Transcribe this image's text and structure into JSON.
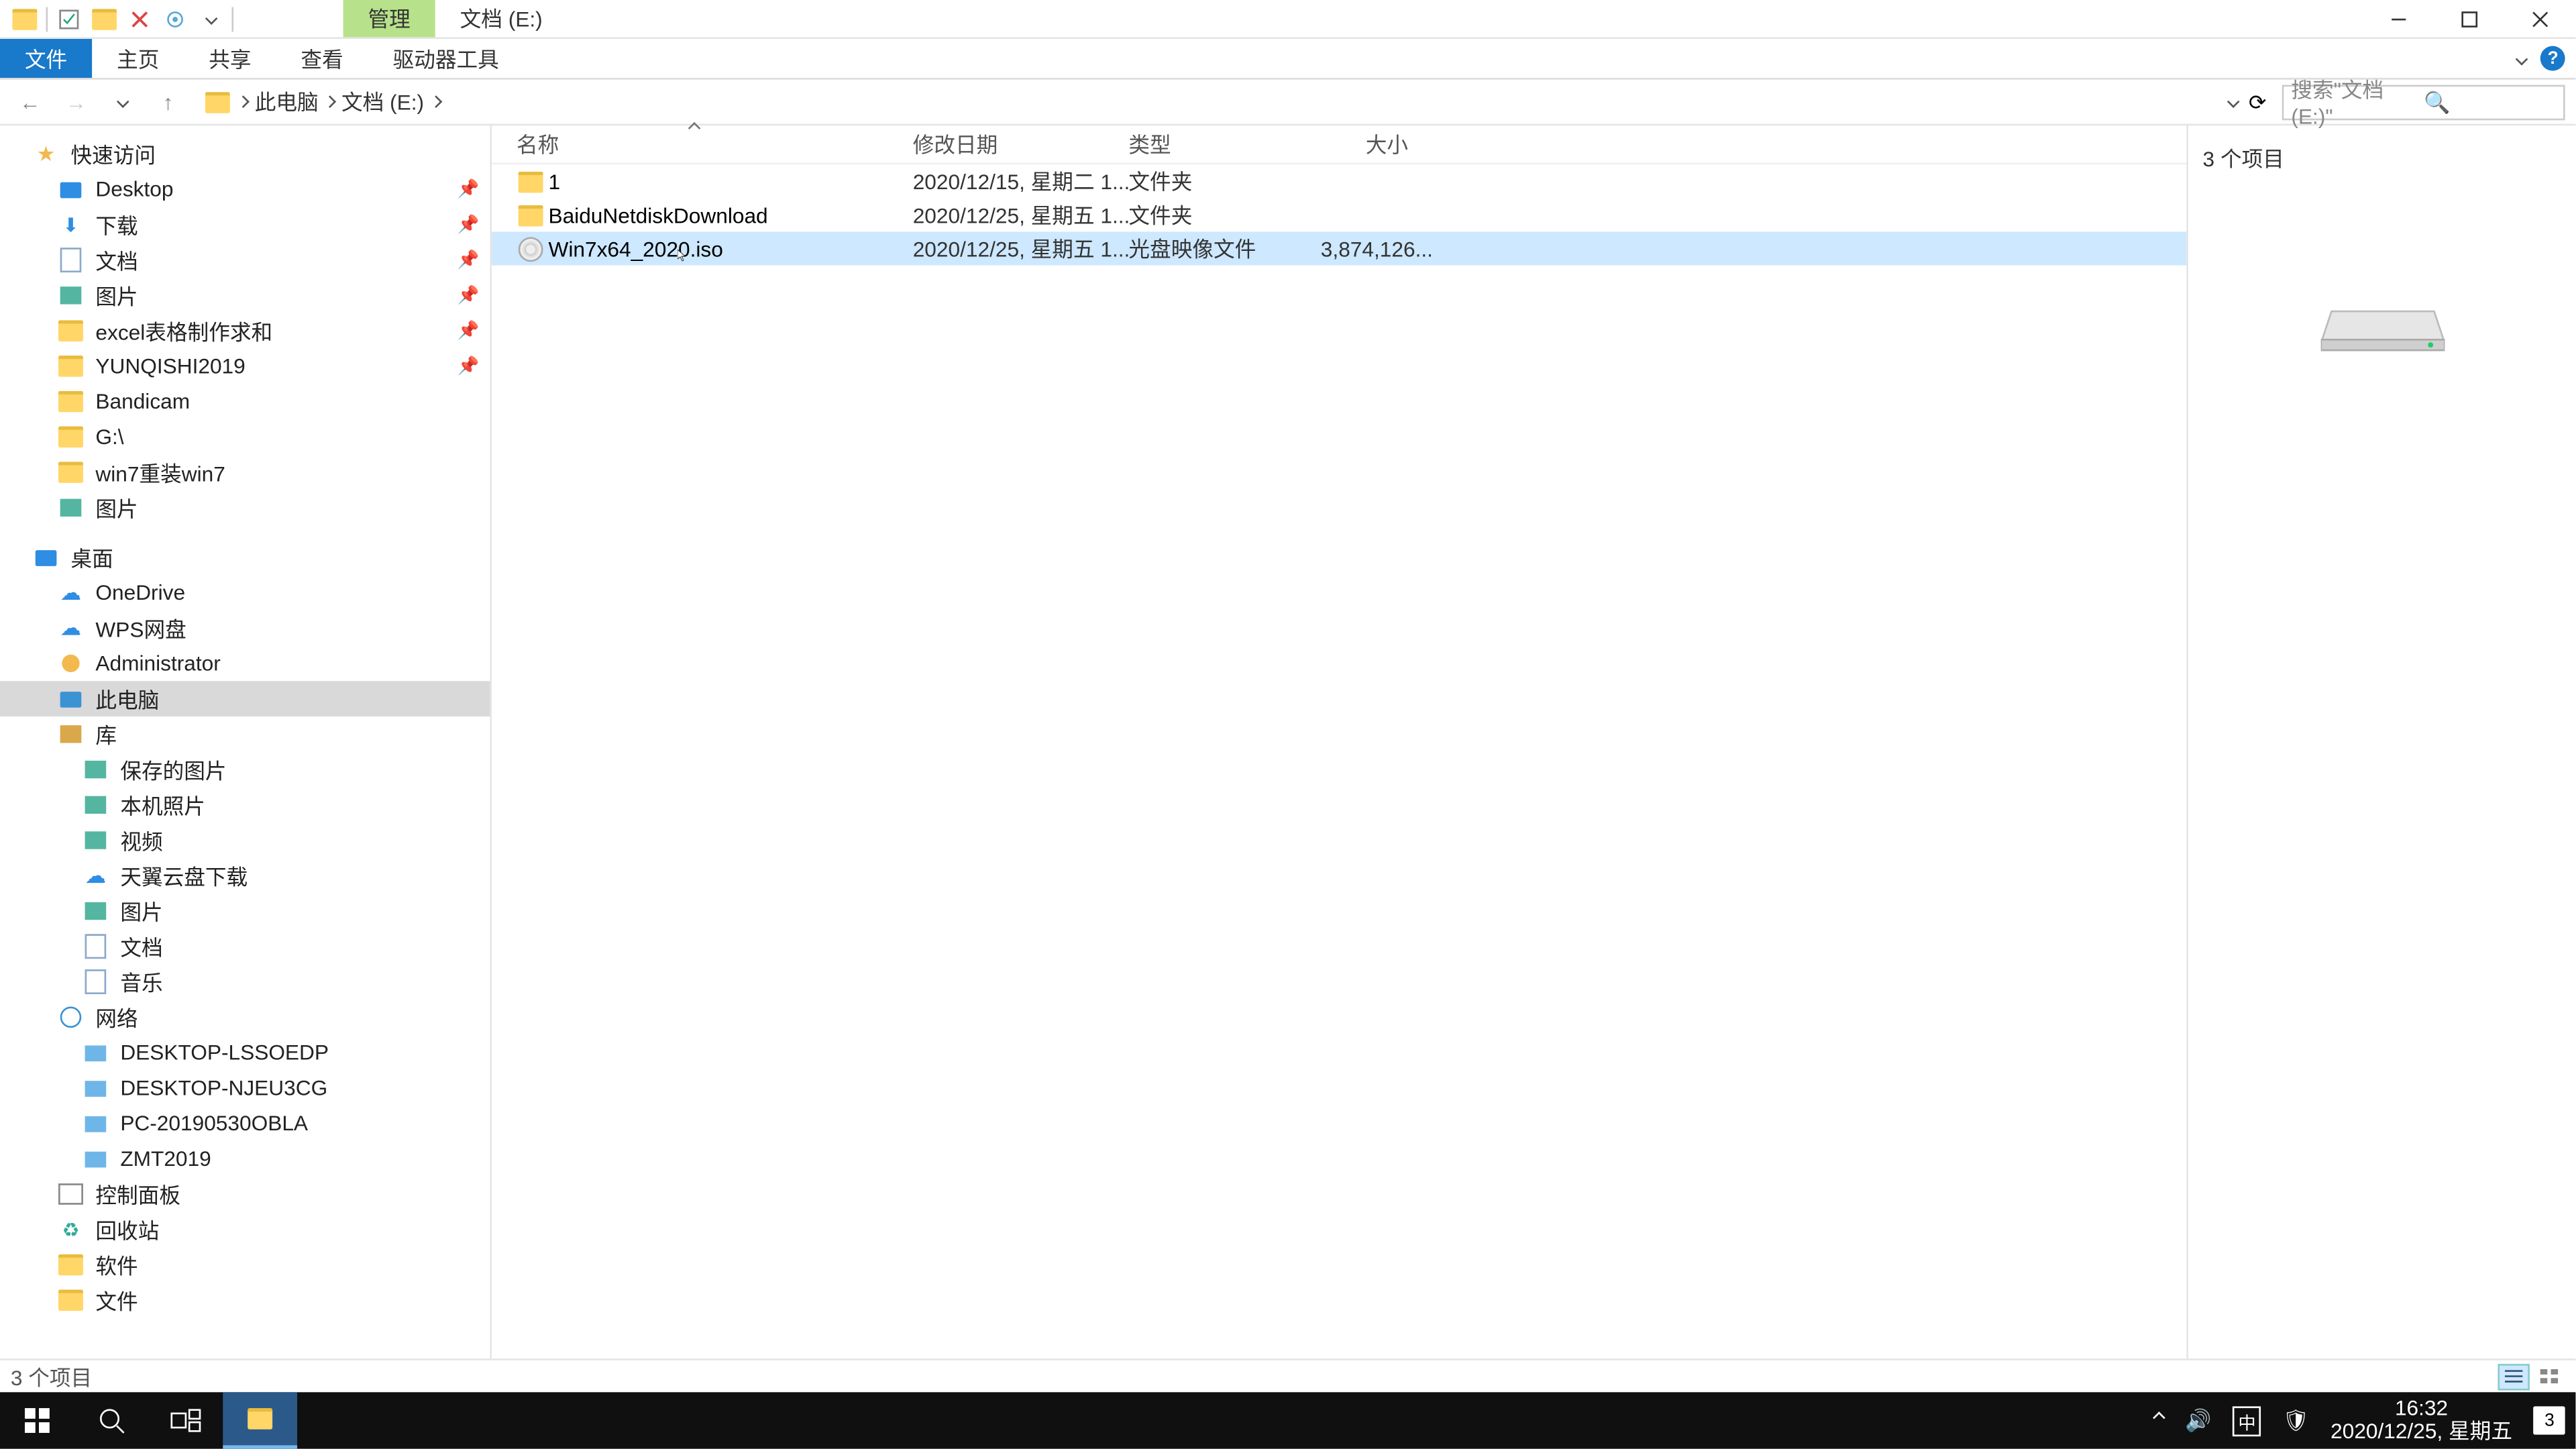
{
  "title": {
    "manage": "管理",
    "location": "文档 (E:)"
  },
  "ribbon": {
    "file": "文件",
    "home": "主页",
    "share": "共享",
    "view": "查看",
    "drive": "驱动器工具"
  },
  "breadcrumb": {
    "this_pc": "此电脑",
    "drive": "文档 (E:)"
  },
  "search": {
    "placeholder": "搜索\"文档 (E:)\""
  },
  "tree": {
    "quick": "快速访问",
    "q_items": [
      {
        "l": "Desktop",
        "ic": "desk"
      },
      {
        "l": "下载",
        "ic": "dl"
      },
      {
        "l": "文档",
        "ic": "doc"
      },
      {
        "l": "图片",
        "ic": "img"
      },
      {
        "l": "excel表格制作求和",
        "ic": "folder"
      },
      {
        "l": "YUNQISHI2019",
        "ic": "folder"
      },
      {
        "l": "Bandicam",
        "ic": "folder"
      },
      {
        "l": "G:\\",
        "ic": "folder"
      },
      {
        "l": "win7重装win7",
        "ic": "folder"
      },
      {
        "l": "图片",
        "ic": "img"
      }
    ],
    "desktop": "桌面",
    "d_items": [
      {
        "l": "OneDrive",
        "ic": "cloud"
      },
      {
        "l": "WPS网盘",
        "ic": "cloud"
      },
      {
        "l": "Administrator",
        "ic": "user"
      },
      {
        "l": "此电脑",
        "ic": "pc",
        "sel": true
      },
      {
        "l": "库",
        "ic": "lib"
      }
    ],
    "lib_items": [
      {
        "l": "保存的图片",
        "ic": "img"
      },
      {
        "l": "本机照片",
        "ic": "img"
      },
      {
        "l": "视频",
        "ic": "img"
      },
      {
        "l": "天翼云盘下载",
        "ic": "cloud"
      },
      {
        "l": "图片",
        "ic": "img"
      },
      {
        "l": "文档",
        "ic": "doc"
      },
      {
        "l": "音乐",
        "ic": "doc"
      }
    ],
    "network": "网络",
    "net_items": [
      {
        "l": "DESKTOP-LSSOEDP",
        "ic": "netpc"
      },
      {
        "l": "DESKTOP-NJEU3CG",
        "ic": "netpc"
      },
      {
        "l": "PC-20190530OBLA",
        "ic": "netpc"
      },
      {
        "l": "ZMT2019",
        "ic": "netpc"
      }
    ],
    "cpl": "控制面板",
    "recycle": "回收站",
    "soft": "软件",
    "files_f": "文件"
  },
  "cols": {
    "name": "名称",
    "date": "修改日期",
    "type": "类型",
    "size": "大小"
  },
  "rows": [
    {
      "ic": "folder",
      "name": "1",
      "date": "2020/12/15, 星期二 1...",
      "type": "文件夹",
      "size": ""
    },
    {
      "ic": "folder",
      "name": "BaiduNetdiskDownload",
      "date": "2020/12/25, 星期五 1...",
      "type": "文件夹",
      "size": ""
    },
    {
      "ic": "iso",
      "name": "Win7x64_2020.iso",
      "date": "2020/12/25, 星期五 1...",
      "type": "光盘映像文件",
      "size": "3,874,126...",
      "sel": true
    }
  ],
  "preview": {
    "count": "3 个项目"
  },
  "status": {
    "count": "3 个项目"
  },
  "clock": {
    "time": "16:32",
    "date": "2020/12/25, 星期五"
  },
  "tray": {
    "ime": "中",
    "notif": "3"
  }
}
